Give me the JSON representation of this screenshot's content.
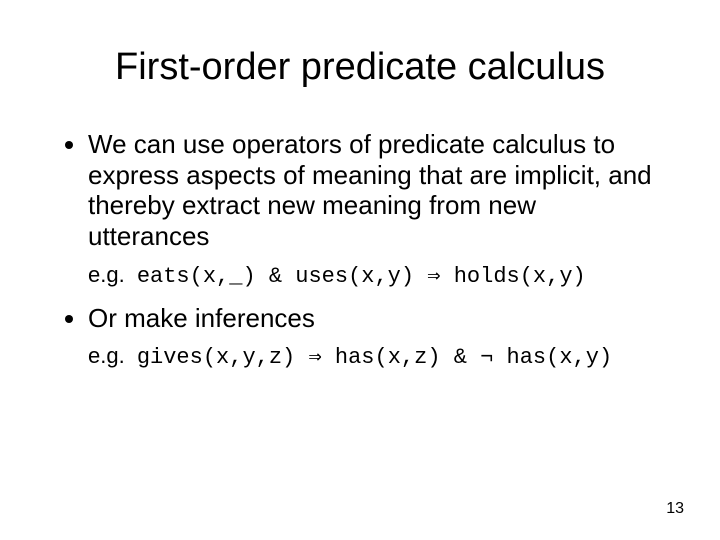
{
  "title": "First-order predicate calculus",
  "bullets": {
    "b1": "We can use operators of predicate calculus to express aspects of meaning that are implicit, and thereby extract new meaning from new utterances",
    "b2": "Or make inferences"
  },
  "examples": {
    "eg_label": "e.g.",
    "e1": "eats(x,_) & uses(x,y) ⇒ holds(x,y)",
    "e2": "gives(x,y,z) ⇒ has(x,z) & ¬ has(x,y)"
  },
  "page_number": "13"
}
